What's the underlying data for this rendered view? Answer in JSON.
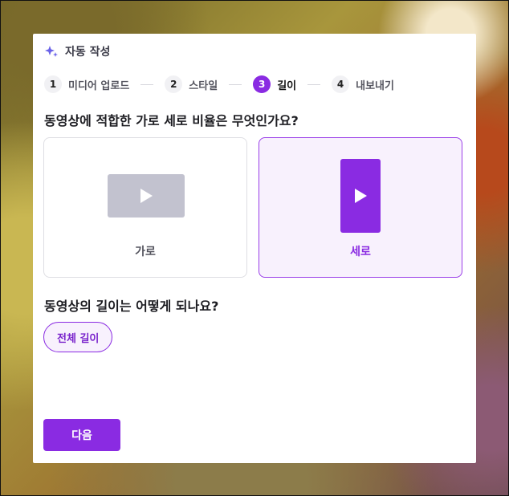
{
  "header": {
    "title": "자동 작성",
    "icon": "sparkle-icon",
    "icon_color": "#6a62e8"
  },
  "steps": [
    {
      "number": "1",
      "label": "미디어 업로드"
    },
    {
      "number": "2",
      "label": "스타일"
    },
    {
      "number": "3",
      "label": "길이",
      "active": true
    },
    {
      "number": "4",
      "label": "내보내기"
    }
  ],
  "questions": {
    "aspect": "동영상에 적합한 가로 세로 비율은 무엇인가요?",
    "length": "동영상의 길이는 어떻게 되나요?"
  },
  "options": {
    "landscape": {
      "label": "가로",
      "icon": "play-icon"
    },
    "portrait": {
      "label": "세로",
      "icon": "play-icon",
      "selected": true
    }
  },
  "length_option": {
    "label": "전체 길이",
    "selected": true
  },
  "next_button": {
    "label": "다음"
  },
  "colors": {
    "accent": "#8a2be2",
    "accent_bg": "#f8f1fd",
    "inactive_thumb": "#c2c2cf"
  }
}
